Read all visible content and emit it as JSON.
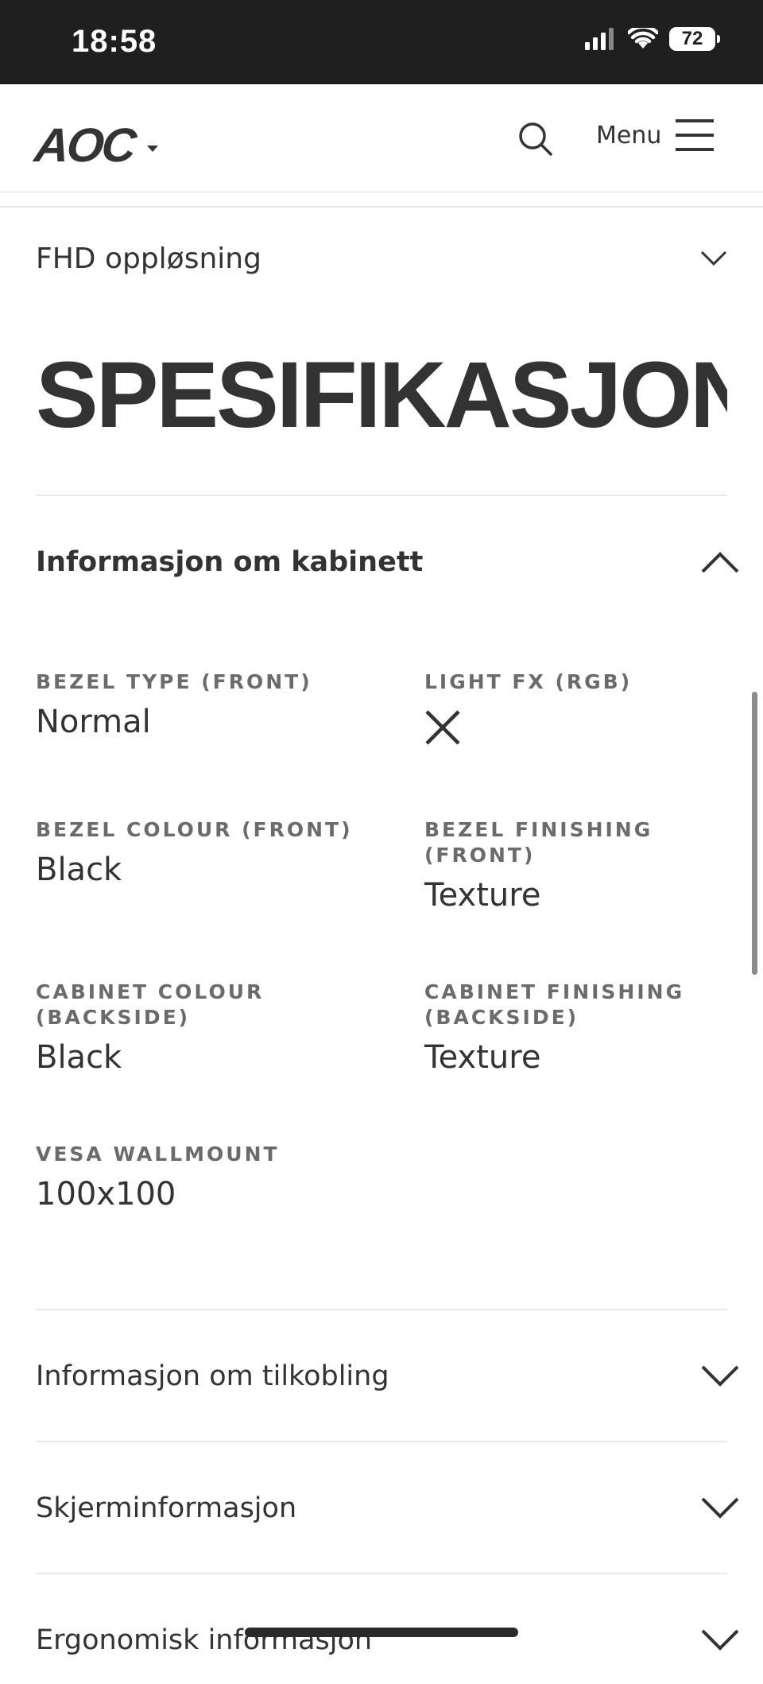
{
  "status_bar": {
    "time": "18:58",
    "battery": "72"
  },
  "header": {
    "logo_text": "AOC",
    "menu_label": "Menu"
  },
  "fhd": {
    "label": "FHD oppløsning"
  },
  "page_title": "SPESIFIKASJONER",
  "cabinet": {
    "title": "Informasjon om kabinett",
    "items": [
      {
        "label": "BEZEL TYPE (FRONT)",
        "value": "Normal"
      },
      {
        "label": "LIGHT FX (RGB)",
        "value": "",
        "icon": "x-icon"
      },
      {
        "label": "BEZEL COLOUR (FRONT)",
        "value": "Black"
      },
      {
        "label": "BEZEL FINISHING (FRONT)",
        "value": "Texture"
      },
      {
        "label": "CABINET COLOUR (BACKSIDE)",
        "value": "Black"
      },
      {
        "label": "CABINET FINISHING (BACKSIDE)",
        "value": "Texture"
      },
      {
        "label": "VESA WALLMOUNT",
        "value": "100x100"
      }
    ]
  },
  "sections": [
    {
      "title": "Informasjon om tilkobling"
    },
    {
      "title": "Skjerminformasjon"
    },
    {
      "title": "Ergonomisk informasjon"
    }
  ],
  "colors": {
    "text": "#333333",
    "label": "#6b6b6b",
    "status_bar": "#1f1f1f",
    "divider": "#e8e8e8"
  }
}
